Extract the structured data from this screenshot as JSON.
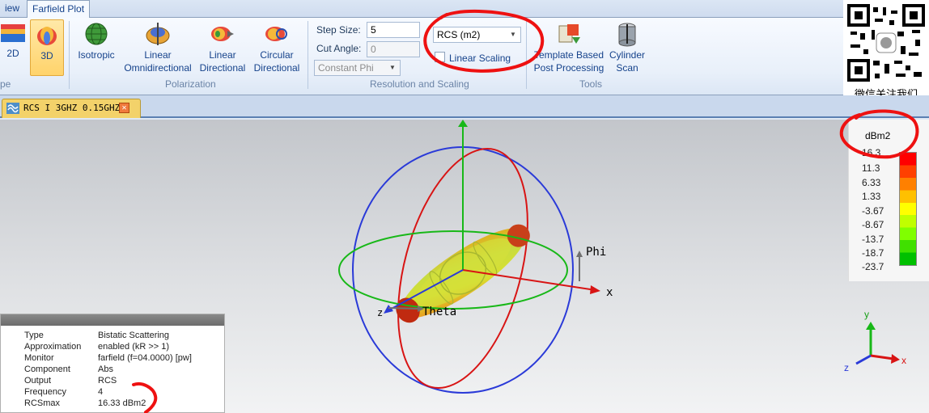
{
  "tabs": {
    "view_label": "iew",
    "farfield_label": "Farfield Plot"
  },
  "ribbon": {
    "btn_2d": "2D",
    "btn_3d": "3D",
    "btn_isotropic": "Isotropic",
    "btn_linear_omni_1": "Linear",
    "btn_linear_omni_2": "Omnidirectional",
    "btn_linear_dir_1": "Linear",
    "btn_linear_dir_2": "Directional",
    "btn_circular_dir_1": "Circular",
    "btn_circular_dir_2": "Directional",
    "group_polarization": "Polarization",
    "group_type_partial": "pe",
    "step_size_label": "Step Size:",
    "step_size_value": "5",
    "cut_angle_label": "Cut Angle:",
    "cut_angle_value": "0",
    "cut_mode_value": "Constant Phi",
    "output_select_value": "RCS (m2)",
    "linear_scaling_label": "Linear Scaling",
    "group_resolution": "Resolution and Scaling",
    "btn_template_1": "Template Based",
    "btn_template_2": "Post Processing",
    "btn_cylinder_1": "Cylinder",
    "btn_cylinder_2": "Scan",
    "group_tools": "Tools"
  },
  "qr_caption": "微信关注我们",
  "document_tab": {
    "title": "RCS I 3GHZ 0.15GHZ*"
  },
  "plot": {
    "axis_x": "x",
    "axis_z": "z",
    "label_phi": "Phi",
    "label_theta": "Theta",
    "mini_axis_x": "x",
    "mini_axis_y": "y",
    "mini_axis_z": "z"
  },
  "legend": {
    "unit": "dBm2",
    "values": [
      "16.3",
      "11.3",
      "6.33",
      "1.33",
      "-3.67",
      "-8.67",
      "-13.7",
      "-18.7",
      "-23.7"
    ],
    "colors": [
      "#ff0000",
      "#ff4000",
      "#ff8000",
      "#ffc000",
      "#ffff00",
      "#c0ff00",
      "#80ff00",
      "#40e000",
      "#00c000"
    ]
  },
  "info": {
    "rows": [
      {
        "key": "Type",
        "value": "Bistatic Scattering"
      },
      {
        "key": "Approximation",
        "value": "enabled (kR >> 1)"
      },
      {
        "key": "Monitor",
        "value": "farfield (f=04.0000) [pw]"
      },
      {
        "key": "Component",
        "value": "Abs"
      },
      {
        "key": "Output",
        "value": "RCS"
      },
      {
        "key": "Frequency",
        "value": "4"
      },
      {
        "key": "RCSmax",
        "value": "16.33 dBm2"
      }
    ]
  },
  "annotation_color": "#ee1111"
}
